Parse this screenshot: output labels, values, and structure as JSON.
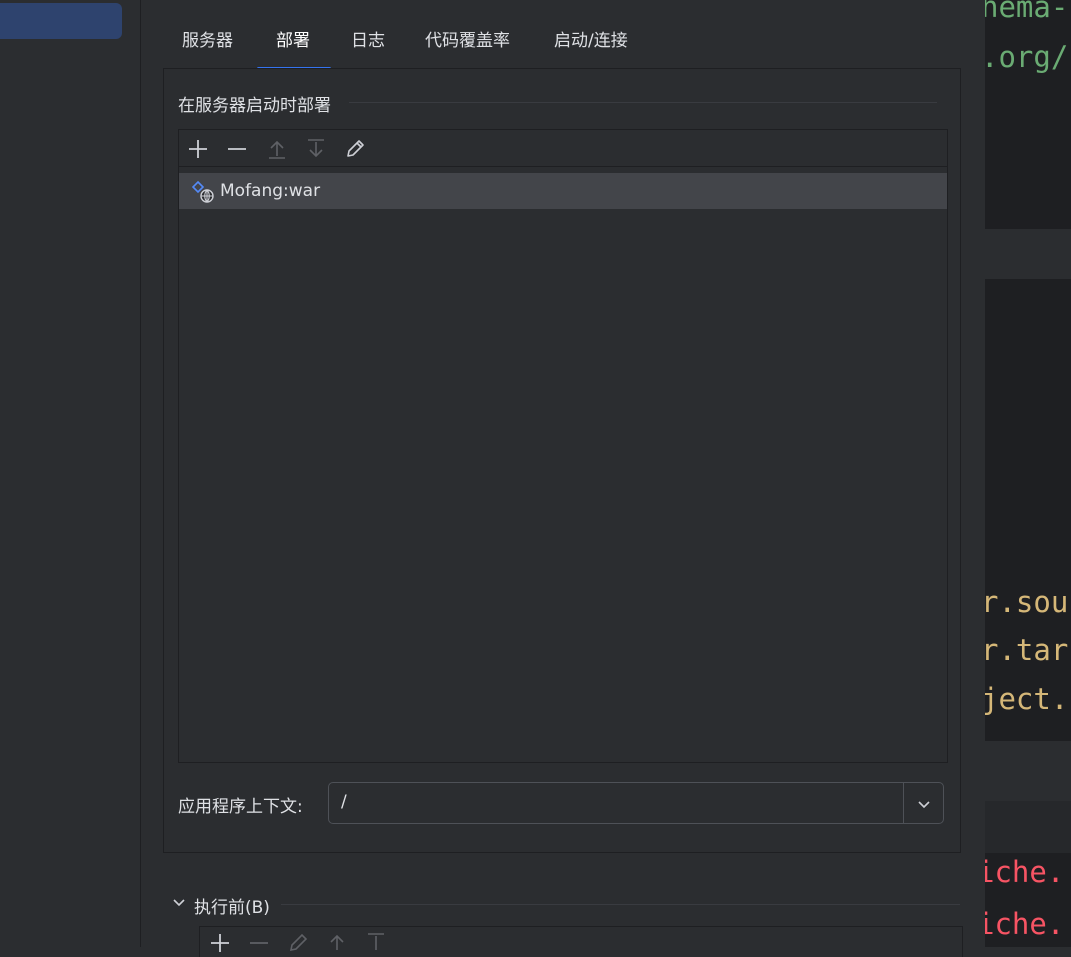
{
  "tabs": [
    {
      "label": "服务器"
    },
    {
      "label": "部署"
    },
    {
      "label": "日志"
    },
    {
      "label": "代码覆盖率"
    },
    {
      "label": "启动/连接"
    }
  ],
  "active_tab": "部署",
  "deploy_group": {
    "title": "在服务器启动时部署",
    "toolbar": [
      "add-icon",
      "remove-icon",
      "move-up-icon",
      "move-down-icon",
      "edit-icon"
    ],
    "items": [
      {
        "label": "Mofang:war",
        "icon": "artifact-web-icon",
        "selected": true
      }
    ]
  },
  "context": {
    "label": "应用程序上下文:",
    "value": "/"
  },
  "before_launch": {
    "label": "执行前(B)",
    "toolbar": [
      "add-icon",
      "remove-icon",
      "edit-icon",
      "move-up-icon",
      "move-down-icon"
    ]
  },
  "editor_fragments": [
    {
      "text": "hema-",
      "color": "#6aab73"
    },
    {
      "text": ".org/",
      "color": "#6aab73"
    },
    {
      "text": "r.sou",
      "color": "#d5b778"
    },
    {
      "text": "r.tar",
      "color": "#d5b778"
    },
    {
      "text": "ject.",
      "color": "#d5b778"
    },
    {
      "text": "iche.",
      "color": "#f75464"
    },
    {
      "text": "iche.",
      "color": "#f75464"
    }
  ],
  "colors": {
    "accent": "#3574f0",
    "background": "#2b2d30",
    "selection": "#43454a"
  }
}
